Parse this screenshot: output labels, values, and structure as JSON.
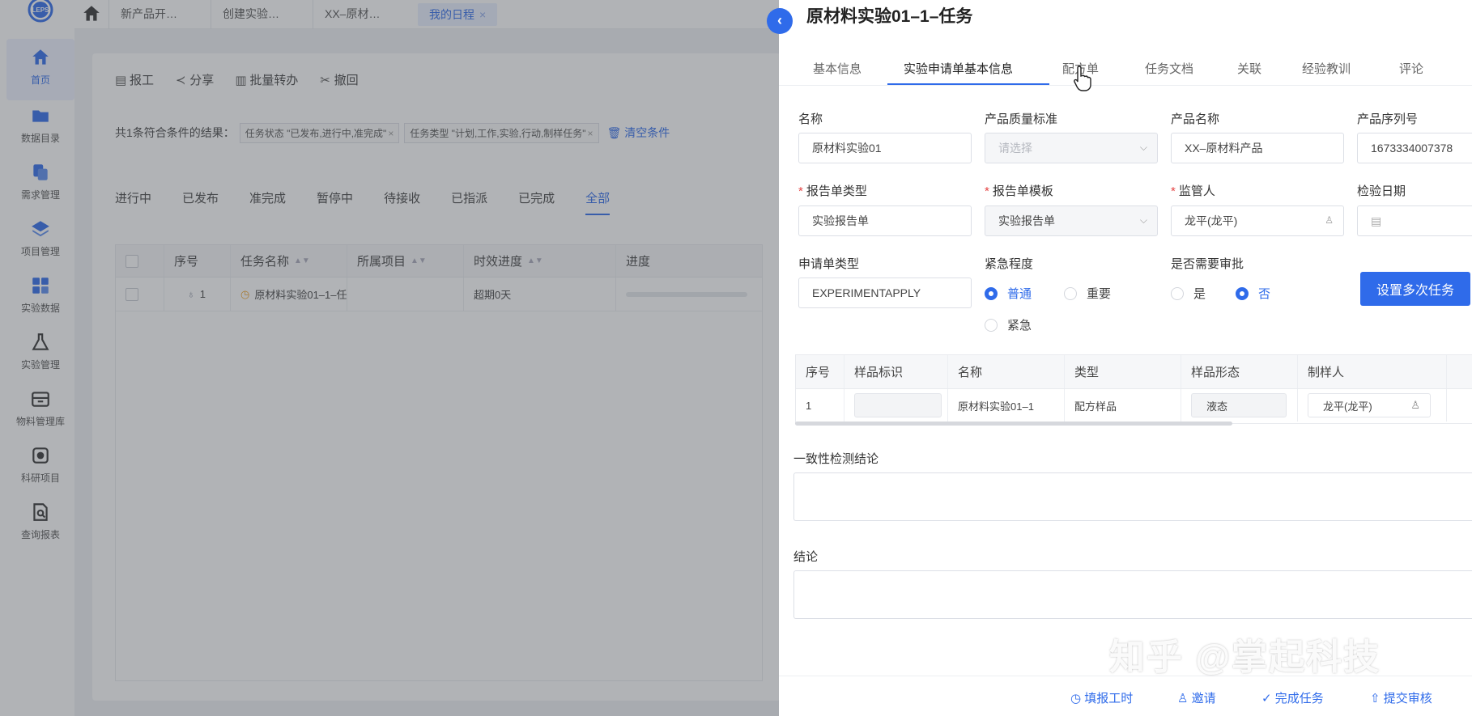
{
  "nav": {
    "logo_text": "LEPS",
    "items": [
      {
        "label": "首页",
        "icon": "home-icon"
      },
      {
        "label": "数据目录",
        "icon": "folder-icon"
      },
      {
        "label": "需求管理",
        "icon": "copy-icon"
      },
      {
        "label": "项目管理",
        "icon": "layers-icon"
      },
      {
        "label": "实验数据",
        "icon": "grid-icon"
      },
      {
        "label": "实验管理",
        "icon": "flask-icon"
      },
      {
        "label": "物料管理库",
        "icon": "archive-icon"
      },
      {
        "label": "科研项目",
        "icon": "research-icon"
      },
      {
        "label": "查询报表",
        "icon": "report-search-icon"
      }
    ]
  },
  "topbar": {
    "tabs": [
      "新产品开…",
      "创建实验…",
      "XX–原材…",
      "我的日程"
    ],
    "close": "×"
  },
  "toolbar": {
    "report": "报工",
    "share": "分享",
    "batch_transfer": "批量转办",
    "revoke": "撤回"
  },
  "filter": {
    "summary": "共1条符合条件的结果：",
    "chips": [
      "任务状态 \"已发布,进行中,准完成\"",
      "任务类型 \"计划,工作,实验,行动,制样任务\""
    ],
    "clear": "清空条件"
  },
  "status_tabs": [
    "进行中",
    "已发布",
    "准完成",
    "暂停中",
    "待接收",
    "已指派",
    "已完成",
    "全部"
  ],
  "grid": {
    "headers": [
      "序号",
      "任务名称",
      "所属项目",
      "时效进度",
      "进度"
    ],
    "row": {
      "index": "1",
      "name": "原材料实验01–1–任",
      "timeliness": "超期0天"
    }
  },
  "drawer": {
    "title": "原材料实验01–1–任务",
    "tabs": [
      "基本信息",
      "实验申请单基本信息",
      "配方单",
      "任务文档",
      "关联",
      "经验教训",
      "评论"
    ],
    "fields": {
      "name_label": "名称",
      "name_value": "原材料实验01",
      "quality_label": "产品质量标准",
      "quality_placeholder": "请选择",
      "product_label": "产品名称",
      "product_value": "XX–原材料产品",
      "serial_label": "产品序列号",
      "serial_value": "1673334007378",
      "report_type_label": "报告单类型",
      "report_type_value": "实验报告单",
      "report_tpl_label": "报告单模板",
      "report_tpl_value": "实验报告单",
      "supervisor_label": "监管人",
      "supervisor_value": "龙平(龙平)",
      "check_date_label": "检验日期",
      "apply_type_label": "申请单类型",
      "apply_type_value": "EXPERIMENTAPPLY",
      "urgency_label": "紧急程度",
      "urgency_options": [
        "普通",
        "重要",
        "紧急"
      ],
      "approval_label": "是否需要审批",
      "approval_options": [
        "是",
        "否"
      ],
      "multi_task_button": "设置多次任务"
    },
    "sample_table": {
      "headers": [
        "序号",
        "样品标识",
        "名称",
        "类型",
        "样品形态",
        "制样人"
      ],
      "row": {
        "index": "1",
        "name": "原材料实验01–1",
        "type": "配方样品",
        "form": "液态",
        "maker": "龙平(龙平)"
      }
    },
    "consistency_label": "一致性检测结论",
    "conclusion_label": "结论",
    "footer": {
      "fill_hours": "填报工时",
      "invite": "邀请",
      "complete": "完成任务",
      "submit": "提交审核"
    }
  },
  "watermark": "知乎 @掌起科技",
  "colors": {
    "accent": "#2f6bea",
    "required": "#e54545",
    "overdue_icon": "#f0a020"
  }
}
